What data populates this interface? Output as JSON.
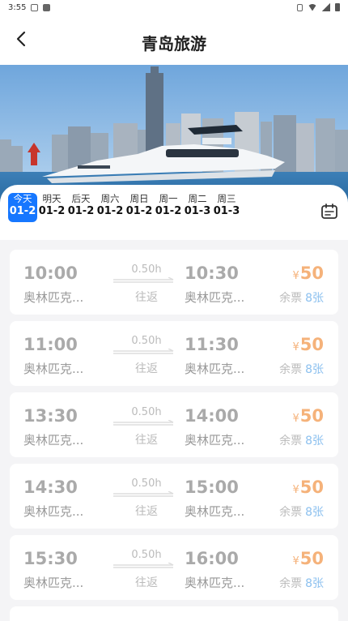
{
  "status_bar": {
    "time": "3:55"
  },
  "header": {
    "title": "青岛旅游"
  },
  "banner": {
    "image_alt": "yacht-cityscape"
  },
  "dates": [
    {
      "dow": "今天",
      "date": "01-2",
      "active": true
    },
    {
      "dow": "明天",
      "date": "01-2"
    },
    {
      "dow": "后天",
      "date": "01-2"
    },
    {
      "dow": "周六",
      "date": "01-2"
    },
    {
      "dow": "周日",
      "date": "01-2"
    },
    {
      "dow": "周一",
      "date": "01-2"
    },
    {
      "dow": "周二",
      "date": "01-3"
    },
    {
      "dow": "周三",
      "date": "01-3"
    }
  ],
  "trips": [
    {
      "dep_time": "10:00",
      "dep_place": "奥林匹克...",
      "duration": "0.50h",
      "trip_type": "往返",
      "arr_time": "10:30",
      "arr_place": "奥林匹克...",
      "currency": "¥",
      "price": "50",
      "remain_label": "余票",
      "remain": "8张"
    },
    {
      "dep_time": "11:00",
      "dep_place": "奥林匹克...",
      "duration": "0.50h",
      "trip_type": "往返",
      "arr_time": "11:30",
      "arr_place": "奥林匹克...",
      "currency": "¥",
      "price": "50",
      "remain_label": "余票",
      "remain": "8张"
    },
    {
      "dep_time": "13:30",
      "dep_place": "奥林匹克...",
      "duration": "0.50h",
      "trip_type": "往返",
      "arr_time": "14:00",
      "arr_place": "奥林匹克...",
      "currency": "¥",
      "price": "50",
      "remain_label": "余票",
      "remain": "8张"
    },
    {
      "dep_time": "14:30",
      "dep_place": "奥林匹克...",
      "duration": "0.50h",
      "trip_type": "往返",
      "arr_time": "15:00",
      "arr_place": "奥林匹克...",
      "currency": "¥",
      "price": "50",
      "remain_label": "余票",
      "remain": "8张"
    },
    {
      "dep_time": "15:30",
      "dep_place": "奥林匹克...",
      "duration": "0.50h",
      "trip_type": "往返",
      "arr_time": "16:00",
      "arr_place": "奥林匹克...",
      "currency": "¥",
      "price": "50",
      "remain_label": "余票",
      "remain": "8张"
    }
  ],
  "colors": {
    "accent": "#1677ff",
    "price": "#f5b27a",
    "remain": "#8cc0ef"
  }
}
